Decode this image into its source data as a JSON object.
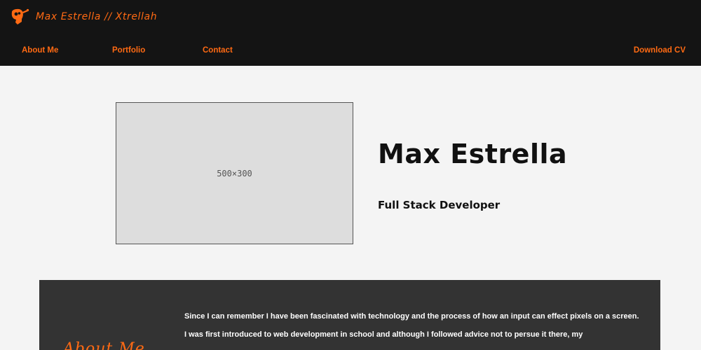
{
  "header": {
    "brand": "Max Estrella // Xtrellah",
    "logo_icon": "mascot-logo-icon",
    "nav": {
      "about": "About Me",
      "portfolio": "Portfolio",
      "contact": "Contact",
      "download_cv": "Download CV"
    }
  },
  "hero": {
    "image_placeholder": "500×300",
    "name": "Max Estrella",
    "role": "Full Stack Developer"
  },
  "about": {
    "heading": "About Me",
    "paragraphs": [
      "Since I can remember I have been fascinated with technology and the process of how an input can effect pixels on a screen.",
      "I was first introduced to web development in school and although I followed advice not to persue it there, my"
    ]
  },
  "colors": {
    "accent": "#ff6a13",
    "header_bg": "#141414",
    "page_bg": "#f4f4f4",
    "section_bg": "#333333"
  }
}
